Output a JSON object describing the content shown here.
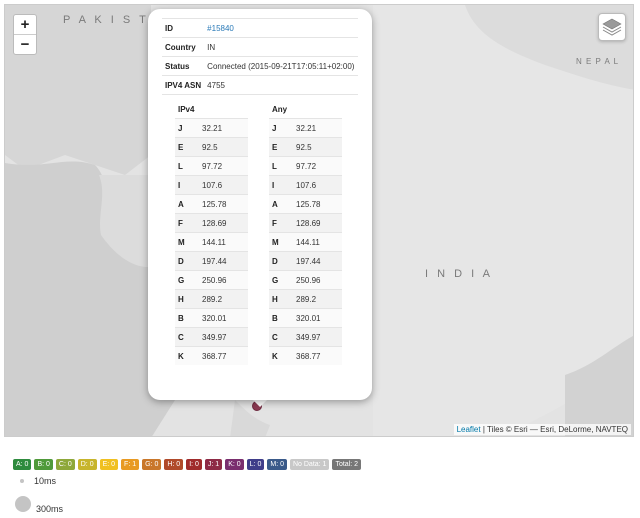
{
  "map": {
    "labels": {
      "pakistan": "P A K I S T A N",
      "india": "I N D I A",
      "nepal": "N E P A L"
    },
    "zoom_in": "+",
    "zoom_out": "−",
    "attribution_link": "Leaflet",
    "attribution_text": " | Tiles © Esri — Esri, DeLorme, NAVTEQ"
  },
  "popup": {
    "info": [
      {
        "key": "ID",
        "value": "#15840",
        "link": true
      },
      {
        "key": "Country",
        "value": "IN"
      },
      {
        "key": "Status",
        "value": "Connected (2015-09-21T17:05:11+02:00)"
      },
      {
        "key": "IPV4 ASN",
        "value": "4755"
      }
    ],
    "ipv4": {
      "header": "IPv4",
      "rows": [
        [
          "J",
          "32.21"
        ],
        [
          "E",
          "92.5"
        ],
        [
          "L",
          "97.72"
        ],
        [
          "I",
          "107.6"
        ],
        [
          "A",
          "125.78"
        ],
        [
          "F",
          "128.69"
        ],
        [
          "M",
          "144.11"
        ],
        [
          "D",
          "197.44"
        ],
        [
          "G",
          "250.96"
        ],
        [
          "H",
          "289.2"
        ],
        [
          "B",
          "320.01"
        ],
        [
          "C",
          "349.97"
        ],
        [
          "K",
          "368.77"
        ]
      ]
    },
    "any": {
      "header": "Any",
      "rows": [
        [
          "J",
          "32.21"
        ],
        [
          "E",
          "92.5"
        ],
        [
          "L",
          "97.72"
        ],
        [
          "I",
          "107.6"
        ],
        [
          "A",
          "125.78"
        ],
        [
          "F",
          "128.69"
        ],
        [
          "M",
          "144.11"
        ],
        [
          "D",
          "197.44"
        ],
        [
          "G",
          "250.96"
        ],
        [
          "H",
          "289.2"
        ],
        [
          "B",
          "320.01"
        ],
        [
          "C",
          "349.97"
        ],
        [
          "K",
          "368.77"
        ]
      ]
    }
  },
  "badges": [
    {
      "label": "A: 0",
      "color": "#2e8b3e"
    },
    {
      "label": "B: 0",
      "color": "#4f9a3a"
    },
    {
      "label": "C: 0",
      "color": "#8ea83a"
    },
    {
      "label": "D: 0",
      "color": "#c7b52c"
    },
    {
      "label": "E: 0",
      "color": "#f0c020"
    },
    {
      "label": "F: 1",
      "color": "#e89a22"
    },
    {
      "label": "G: 0",
      "color": "#c9772a"
    },
    {
      "label": "H: 0",
      "color": "#b04a2a"
    },
    {
      "label": "I: 0",
      "color": "#a02b2b"
    },
    {
      "label": "J: 1",
      "color": "#8e2a45"
    },
    {
      "label": "K: 0",
      "color": "#7a2e6e"
    },
    {
      "label": "L: 0",
      "color": "#3f3d8a"
    },
    {
      "label": "M: 0",
      "color": "#3a5a8a"
    },
    {
      "label": "No Data: 1",
      "color": "#c8c8c8"
    },
    {
      "label": "Total: 2",
      "color": "#777777"
    }
  ],
  "legend": {
    "small": "10ms",
    "large": "300ms"
  }
}
